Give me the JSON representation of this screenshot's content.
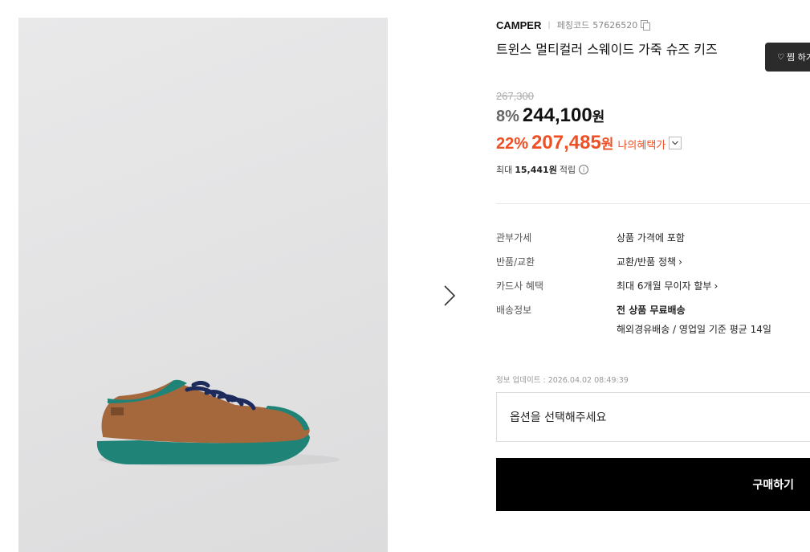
{
  "product": {
    "brand": "CAMPER",
    "code_label": "페칭코드",
    "code": "57626520",
    "title": "트윈스 멀티컬러 스웨이드 가죽 슈즈 키즈",
    "image_alt": "Brown suede kids shoe with green sole and navy laces"
  },
  "wishlist": {
    "label": "찜 하기",
    "icon": "heart-icon"
  },
  "pricing": {
    "original_price": "267,300",
    "discount_rate": "8%",
    "price": "244,100",
    "currency": "원",
    "benefit_rate": "22%",
    "benefit_price": "207,485",
    "benefit_label": "나의혜택가",
    "points_prefix": "최대",
    "points_amount": "15,441원",
    "points_suffix": "적립"
  },
  "details": [
    {
      "key": "관부가세",
      "value": "상품 가격에 포함"
    },
    {
      "key": "반품/교환",
      "value": "교환/반품 정책"
    },
    {
      "key": "카드사 혜택",
      "value": "최대 6개월 무이자 할부"
    },
    {
      "key": "배송정보",
      "value": "전 상품 무료배송",
      "value2": "해외경유배송 / 영업일 기준 평균 14일"
    }
  ],
  "update_info": "정보 업데이트 : 2026.04.02 08:49:39",
  "option_placeholder": "옵션을 선택해주세요",
  "buy_label": "구매하기",
  "colors": {
    "accent": "#f04e23",
    "buy_button": "#000000",
    "wish_button": "#2b2b2b"
  }
}
